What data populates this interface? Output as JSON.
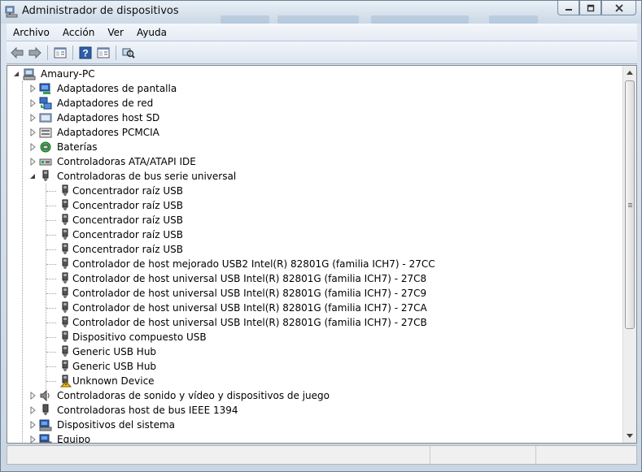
{
  "window": {
    "title": "Administrador de dispositivos",
    "controls": [
      "minimize",
      "restore",
      "close"
    ]
  },
  "menubar": {
    "items": [
      "Archivo",
      "Acción",
      "Ver",
      "Ayuda"
    ]
  },
  "toolbar": {
    "buttons": [
      "back-arrow-icon",
      "forward-arrow-icon",
      "show-hide-console-tree-icon",
      "help-icon",
      "properties-icon",
      "scan-hardware-icon"
    ]
  },
  "tree": {
    "root": {
      "label": "Amaury-PC",
      "expanded": true
    },
    "categories": [
      {
        "label": "Adaptadores de pantalla",
        "icon": "display-adapter-icon",
        "expanded": false
      },
      {
        "label": "Adaptadores de red",
        "icon": "network-adapter-icon",
        "expanded": false
      },
      {
        "label": "Adaptadores host SD",
        "icon": "sd-host-icon",
        "expanded": false
      },
      {
        "label": "Adaptadores PCMCIA",
        "icon": "pcmcia-icon",
        "expanded": false
      },
      {
        "label": "Baterías",
        "icon": "battery-icon",
        "expanded": false
      },
      {
        "label": "Controladoras ATA/ATAPI IDE",
        "icon": "ide-controller-icon",
        "expanded": false
      },
      {
        "label": "Controladoras de bus serie universal",
        "icon": "usb-icon",
        "expanded": true
      }
    ],
    "usb_children": [
      {
        "label": "Concentrador raíz USB",
        "warning": false
      },
      {
        "label": "Concentrador raíz USB",
        "warning": false
      },
      {
        "label": "Concentrador raíz USB",
        "warning": false
      },
      {
        "label": "Concentrador raíz USB",
        "warning": false
      },
      {
        "label": "Concentrador raíz USB",
        "warning": false
      },
      {
        "label": "Controlador de host mejorado USB2 Intel(R) 82801G (familia ICH7) - 27CC",
        "warning": false
      },
      {
        "label": "Controlador de host universal USB Intel(R) 82801G (familia ICH7) - 27C8",
        "warning": false
      },
      {
        "label": "Controlador de host universal USB Intel(R) 82801G (familia ICH7) - 27C9",
        "warning": false
      },
      {
        "label": "Controlador de host universal USB Intel(R) 82801G (familia ICH7) - 27CA",
        "warning": false
      },
      {
        "label": "Controlador de host universal USB Intel(R) 82801G (familia ICH7) - 27CB",
        "warning": false
      },
      {
        "label": "Dispositivo compuesto USB",
        "warning": false
      },
      {
        "label": "Generic USB Hub",
        "warning": false
      },
      {
        "label": "Generic USB Hub",
        "warning": false
      },
      {
        "label": "Unknown Device",
        "warning": true
      }
    ],
    "more_categories": [
      {
        "label": "Controladoras de sonido y vídeo y dispositivos de juego",
        "icon": "sound-icon",
        "expanded": false
      },
      {
        "label": "Controladoras host de bus IEEE 1394",
        "icon": "ieee1394-icon",
        "expanded": false
      },
      {
        "label": "Dispositivos del sistema",
        "icon": "system-devices-icon",
        "expanded": false
      },
      {
        "label": "Equipo",
        "icon": "computer-icon",
        "expanded": false
      }
    ]
  },
  "scrollbar": {
    "position": 0.0
  },
  "colors": {
    "titlebar": "#d6e1ec",
    "tree_background": "#ffffff",
    "warning": "#f5c400"
  }
}
